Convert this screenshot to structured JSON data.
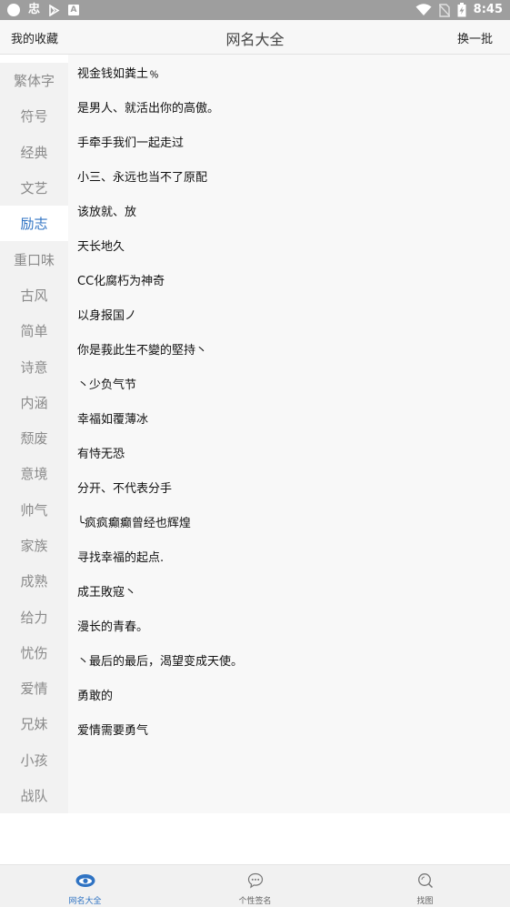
{
  "status_bar": {
    "left_icons": [
      "circle-icon",
      "app-glyph-icon",
      "play-store-icon",
      "a-icon"
    ],
    "glyph": "忠",
    "a_letter": "A",
    "time": "8:45"
  },
  "header": {
    "favorites_label": "我的收藏",
    "title": "网名大全",
    "refresh_label": "换一批"
  },
  "sidebar": {
    "items": [
      "繁体字",
      "符号",
      "经典",
      "文艺",
      "励志",
      "重口味",
      "古风",
      "简单",
      "诗意",
      "内涵",
      "颓废",
      "意境",
      "帅气",
      "家族",
      "成熟",
      "给力",
      "忧伤",
      "爱情",
      "兄妹",
      "小孩",
      "战队"
    ],
    "active": "励志"
  },
  "names": [
    "视金钱如粪土﹪",
    "是男人、就活出你的高傲。",
    "手牵手我们一起走过",
    "小三、永远也当不了原配",
    "该放就、放",
    "天长地久",
    "CC化腐朽为神奇",
    "以身报国ノ",
    "你是莪此生不變的堅持丶",
    "丶少负气节",
    "幸福如覆薄冰",
    "有恃无恐",
    "分开、不代表分手",
    "╰疯疯癫癫曾经也辉煌",
    "寻找幸福的起点.",
    "成王敗寇丶",
    "漫长的青春。",
    "丶最后的最后，渴望变成天使。",
    "勇敢的",
    "爱情需要勇气"
  ],
  "bottom_nav": {
    "tabs": [
      {
        "label": "网名大全",
        "icon": "eye-icon",
        "active": true
      },
      {
        "label": "个性签名",
        "icon": "chat-bubble-icon",
        "active": false
      },
      {
        "label": "找图",
        "icon": "search-icon",
        "active": false
      }
    ]
  },
  "colors": {
    "accent": "#2f73c3",
    "status_bar": "#9e9e9e",
    "sidebar_bg": "#f2f2f2",
    "sidebar_text": "#8a8a8a"
  }
}
